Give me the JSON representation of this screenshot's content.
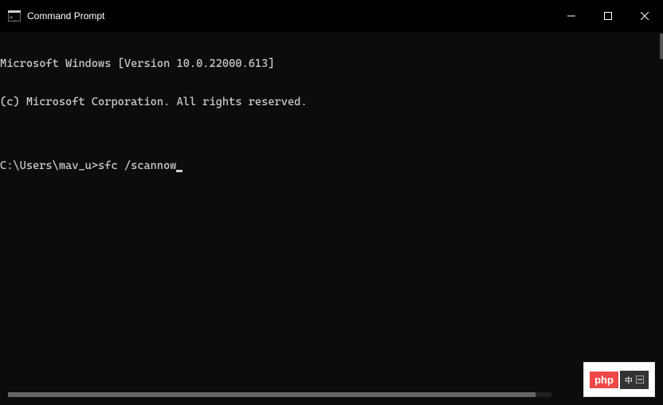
{
  "titlebar": {
    "title": "Command Prompt"
  },
  "terminal": {
    "line1": "Microsoft Windows [Version 10.0.22000.613]",
    "line2": "(c) Microsoft Corporation. All rights reserved.",
    "blank": "",
    "prompt": "C:\\Users\\mav_u>",
    "command": "sfc /scannow"
  },
  "watermark": {
    "text1": "php",
    "text2": "中"
  }
}
